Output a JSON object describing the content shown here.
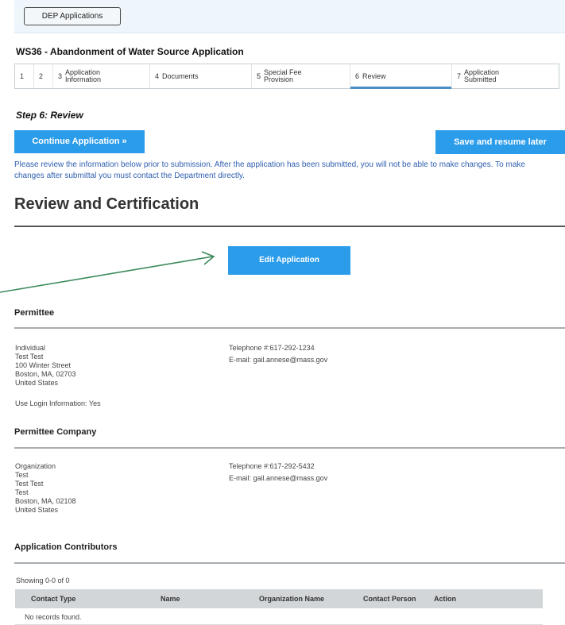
{
  "top": {
    "dep_button": "DEP Applications"
  },
  "app_title": "WS36 - Abandonment of Water Source Application",
  "steps": [
    {
      "num": "1",
      "label": ""
    },
    {
      "num": "2",
      "label": ""
    },
    {
      "num": "3",
      "label": "Application Information"
    },
    {
      "num": "4",
      "label": "Documents"
    },
    {
      "num": "5",
      "label": "Special Fee Provision"
    },
    {
      "num": "6",
      "label": "Review"
    },
    {
      "num": "7",
      "label": "Application Submitted"
    }
  ],
  "step_title": "Step 6: Review",
  "buttons": {
    "continue": "Continue Application »",
    "save": "Save and resume later",
    "edit": "Edit Application"
  },
  "notice": "Please review the information below prior to submission. After the application has been submitted, you will not be able to make changes. To make changes after submittal you must contact the Department directly.",
  "review_heading": "Review and Certification",
  "permittee": {
    "heading": "Permittee",
    "type": "Individual",
    "name": "Test Test",
    "street": "100 Winter Street",
    "city": "Boston, MA, 02703",
    "country": "United States",
    "use_login": "Use Login Information: Yes",
    "telephone": "Telephone #:617-292-1234",
    "email": "E-mail: gail.annese@mass.gov"
  },
  "company": {
    "heading": "Permittee Company",
    "type": "Organization",
    "line1": "Test",
    "line2": "Test Test",
    "line3": "Test",
    "city": "Boston, MA, 02108",
    "country": "United States",
    "telephone": "Telephone #:617-292-5432",
    "email": "E-mail: gail.annese@mass.gov"
  },
  "contributors": {
    "heading": "Application Contributors",
    "showing": "Showing 0-0 of 0",
    "columns": [
      "Contact Type",
      "Name",
      "Organization Name",
      "Contact Person",
      "Action"
    ],
    "empty": "No records found."
  },
  "colors": {
    "accent": "#2b9cea",
    "notice_text": "#2f5fb0",
    "arrow": "#3b8a5a",
    "header_bg": "#eef6fb"
  }
}
